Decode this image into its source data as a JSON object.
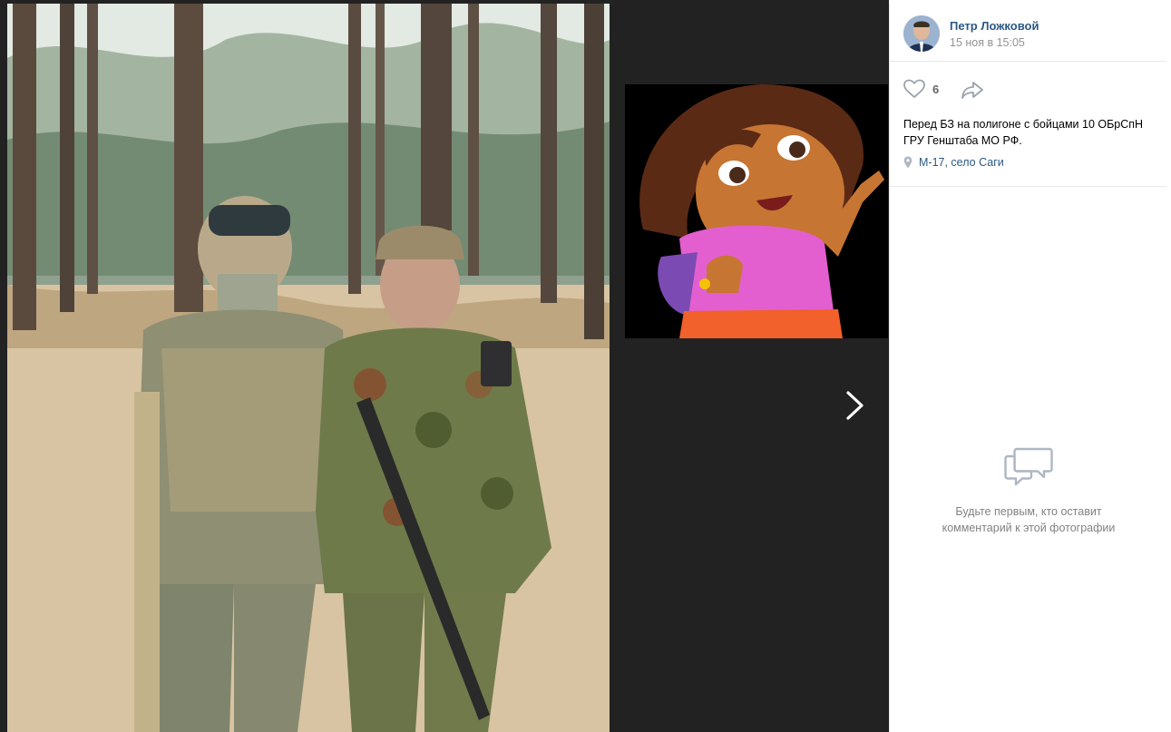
{
  "post": {
    "author_name": "Петр Ложковой",
    "date": "15 ноя в 15:05",
    "likes_count": "6",
    "caption_line1": "Перед БЗ на полигоне с бойцами 10 ОБрСпН",
    "caption_line2": "ГРУ Генштаба МО РФ.",
    "location": "М-17, село Саги"
  },
  "comments": {
    "empty_line1": "Будьте первым, кто оставит",
    "empty_line2": "комментарий к этой фотографии"
  },
  "icons": {
    "like": "heart-icon",
    "share": "share-arrow-icon",
    "location": "map-pin-icon",
    "next": "chevron-right-icon",
    "comments": "speech-bubbles-icon"
  },
  "colors": {
    "viewer_bg": "#222222",
    "link": "#2a5885",
    "muted": "#939393",
    "divider": "#e7e8ec"
  }
}
